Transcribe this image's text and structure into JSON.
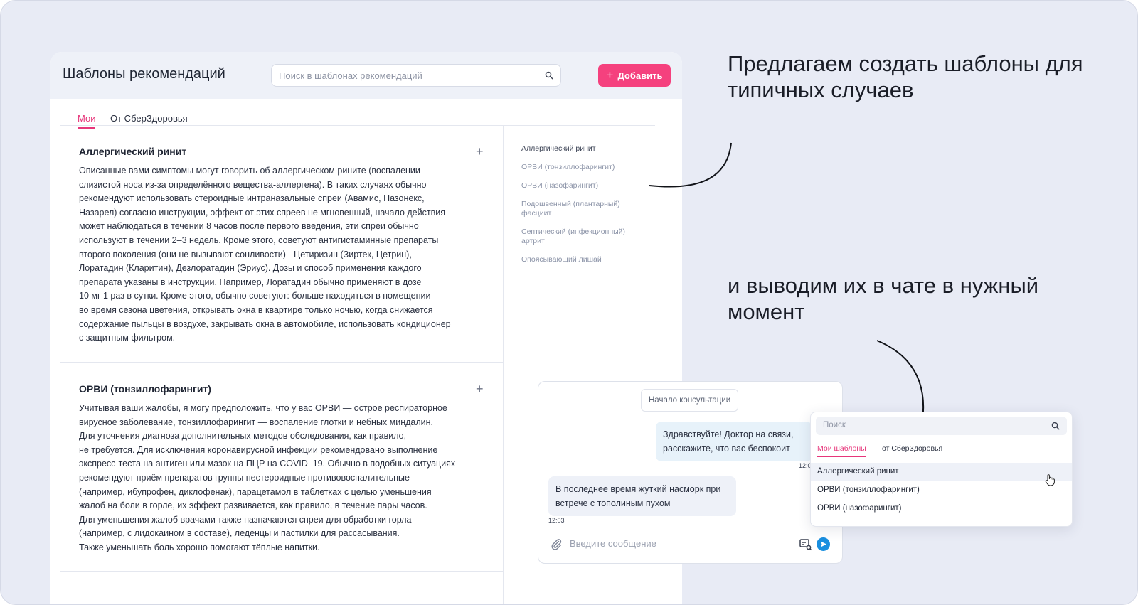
{
  "window": {
    "title": "Шаблоны рекомендаций",
    "search_placeholder": "Поиск в шаблонах рекомендаций",
    "add_label": "Добавить",
    "add_icon": "plus-icon",
    "tabs": [
      {
        "label": "Мои",
        "active": true
      },
      {
        "label": "От СберЗдоровья",
        "active": false
      }
    ],
    "accent": "#f5417e"
  },
  "cards": [
    {
      "title": "Аллергический ринит",
      "lines": [
        "Описанные вами симптомы могут говорить об аллергическом рините (воспалении",
        "слизистой носа из-за определённого вещества-аллергена). В таких случаях обычно",
        "рекомендуют использовать стероидные интраназальные спреи (Авамис, Назонекс,",
        "Назарел) согласно инструкции, эффект от этих спреев не мгновенный, начало действия",
        "может наблюдаться в течении 8 часов после первого введения, эти спреи обычно",
        "используют в течении 2–3 недель. Кроме этого, советуют антигистаминные препараты",
        "второго поколения (они не вызывают сонливости) - Цетиризин (Зиртек, Цетрин),",
        "Лоратадин (Кларитин), Дезлоратадин (Эриус). Дозы и способ применения каждого",
        "препарата указаны в инструкции. Например, Лоратадин обычно применяют в дозе",
        "10 мг 1 раз в сутки. Кроме этого, обычно советуют: больше находиться в помещении",
        "во время сезона цветения, открывать окна в квартире только ночью, когда снижается",
        "содержание пыльцы в воздухе, закрывать окна в автомобиле, использовать кондиционер",
        "с защитным фильтром."
      ]
    },
    {
      "title": "ОРВИ (тонзиллофарингит)",
      "lines": [
        "Учитывая ваши жалобы, я могу предположить, что у вас ОРВИ — острое респираторное",
        "вирусное заболевание, тонзиллофарингит — воспаление глотки и небных миндалин.",
        "Для уточнения диагноза дополнительных методов обследования, как правило,",
        "не требуется. Для исключения коронавирусной инфекции рекомендовано выполнение",
        "экспресс-теста на антиген или мазок на ПЦР на COVID–19. Обычно в подобных ситуациях",
        "рекомендуют приём препаратов группы нестероидные противовоспалительные",
        "(например, ибупрофен, диклофенак), парацетамол в таблетках с целью уменьшения",
        "жалоб на боли в горле, их эффект развивается, как правило, в течение пары часов.",
        "Для уменьшения жалоб врачами также назначаются спреи для обработки горла",
        "(например, с лидокаином в составе), леденцы и пастилки для рассасывания.",
        "Также уменьшать боль хорошо помогают тёплые напитки."
      ]
    }
  ],
  "toc": [
    "Аллергический ринит",
    "ОРВИ (тонзиллофарингит)",
    "ОРВИ (назофарингит)",
    "Подошвенный (плантарный) фасциит",
    "Септический (инфекционный) артрит",
    "Опоясывающий лишай"
  ],
  "promo": {
    "line1": "Предлагаем создать шаблоны для типичных случаев",
    "line2": "и выводим их в чате в нужный момент"
  },
  "chat": {
    "consult_label": "Начало консультации",
    "doctor_message": "Здравствуйте! Доктор на связи, расскажите, что вас беспокоит",
    "doctor_time": "12:03",
    "patient_message": "В последнее время жуткий насморк при встрече с тополиным пухом",
    "patient_time": "12:03",
    "input_placeholder": "Введите сообщение",
    "send_color": "#1a8fdf"
  },
  "dropdown": {
    "search_placeholder": "Поиск",
    "tabs": [
      {
        "label": "Мои шаблоны",
        "active": true
      },
      {
        "label": "от СберЗдоровья",
        "active": false
      }
    ],
    "items": [
      "Аллергический ринит",
      "ОРВИ (тонзиллофарингит)",
      "ОРВИ (назофарингит)"
    ]
  }
}
